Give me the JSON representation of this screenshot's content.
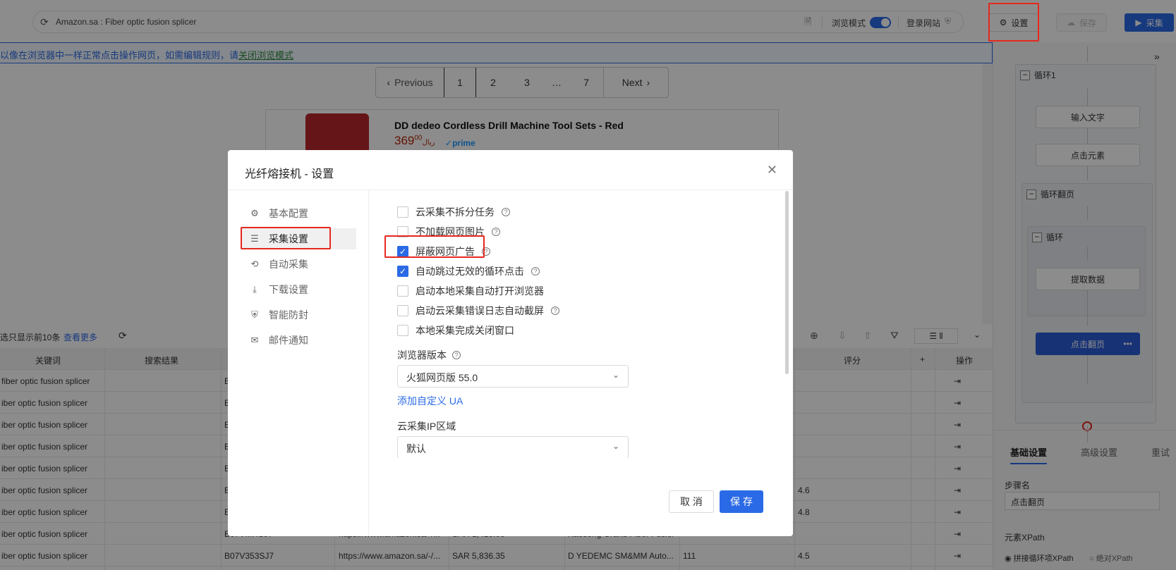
{
  "topbar": {
    "url": "Amazon.sa : Fiber optic fusion splicer",
    "browse_mode_label": "浏览模式",
    "login_site_label": "登录网站",
    "settings_label": "设置",
    "save_label": "保存",
    "collect_label": "采集"
  },
  "notice": {
    "text": "以像在浏览器中一样正常点击操作网页，如需编辑规则，请",
    "link": "关闭浏览模式"
  },
  "pagination": {
    "previous": "Previous",
    "pages": [
      "1",
      "2",
      "3",
      "…",
      "7"
    ],
    "next": "Next"
  },
  "product": {
    "title": "DD dedeo Cordless Drill Machine Tool Sets - Red",
    "currency": "ريال",
    "price": "369",
    "price_cents": "00",
    "prime": "prime"
  },
  "table_toolbar": {
    "info": "选只显示前10条",
    "more": "查看更多"
  },
  "table": {
    "headers": [
      "关键词",
      "搜索结果",
      "评分",
      "+",
      "操作"
    ],
    "rows": [
      {
        "keyword": "fiber optic fusion splicer",
        "col3": "B",
        "col4": "",
        "col5": "",
        "col6": "",
        "col7": "",
        "rating": ""
      },
      {
        "keyword": "iber optic fusion splicer",
        "col3": "B",
        "col4": "",
        "col5": "",
        "col6": "",
        "col7": "",
        "rating": ""
      },
      {
        "keyword": "iber optic fusion splicer",
        "col3": "B",
        "col4": "",
        "col5": "",
        "col6": "",
        "col7": "",
        "rating": ""
      },
      {
        "keyword": "iber optic fusion splicer",
        "col3": "B",
        "col4": "",
        "col5": "",
        "col6": "",
        "col7": "",
        "rating": ""
      },
      {
        "keyword": "iber optic fusion splicer",
        "col3": "B",
        "col4": "",
        "col5": "",
        "col6": "",
        "col7": "",
        "rating": ""
      },
      {
        "keyword": "iber optic fusion splicer",
        "col3": "B",
        "col4": "",
        "col5": "",
        "col6": "",
        "col7": "",
        "rating": "4.6"
      },
      {
        "keyword": "iber optic fusion splicer",
        "col3": "B",
        "col4": "",
        "col5": "",
        "col6": "",
        "col7": "",
        "rating": "4.8"
      },
      {
        "keyword": "iber optic fusion splicer",
        "col3": "B07VMRSJ7",
        "col4": "https://www.amazon.sa/-/...",
        "col5": "SAR 1,410.00",
        "col6": "Kaesong Grand Fiber Fusion...",
        "col7": "",
        "rating": ""
      },
      {
        "keyword": "iber optic fusion splicer",
        "col3": "B07V353SJ7",
        "col4": "https://www.amazon.sa/-/...",
        "col5": "SAR 5,836.35",
        "col6": "D YEDEMC SM&MM Auto...",
        "col7": "111",
        "rating": "4.5"
      }
    ]
  },
  "flow": {
    "loop1": "循环1",
    "input_text": "输入文字",
    "click_element": "点击元素",
    "loop_paging": "循环翻页",
    "loop": "循环",
    "extract_data": "提取数据",
    "click_paging": "点击翻页"
  },
  "right_panel": {
    "tabs": [
      "基础设置",
      "高级设置",
      "重试"
    ],
    "step_name_label": "步骤名",
    "step_name_value": "点击翻页",
    "xpath_label": "元素XPath",
    "radio_concat": "拼接循环项XPath",
    "radio_absolute": "绝对XPath"
  },
  "modal": {
    "title": "光纤熔接机 - 设置",
    "nav": [
      {
        "label": "基本配置",
        "icon": "gear-icon"
      },
      {
        "label": "采集设置",
        "icon": "list-icon"
      },
      {
        "label": "自动采集",
        "icon": "auto-icon"
      },
      {
        "label": "下载设置",
        "icon": "download-icon"
      },
      {
        "label": "智能防封",
        "icon": "shield-icon"
      },
      {
        "label": "邮件通知",
        "icon": "mail-icon"
      }
    ],
    "options": [
      {
        "label": "云采集不拆分任务",
        "checked": false,
        "help": true
      },
      {
        "label": "不加载网页图片",
        "checked": false,
        "help": true
      },
      {
        "label": "屏蔽网页广告",
        "checked": true,
        "help": true
      },
      {
        "label": "自动跳过无效的循环点击",
        "checked": true,
        "help": true
      },
      {
        "label": "启动本地采集自动打开浏览器",
        "checked": false,
        "help": false
      },
      {
        "label": "启动云采集错误日志自动截屏",
        "checked": false,
        "help": true
      },
      {
        "label": "本地采集完成关闭窗口",
        "checked": false,
        "help": false
      }
    ],
    "browser_version_label": "浏览器版本",
    "browser_version_value": "火狐网页版 55.0",
    "custom_ua_link": "添加自定义 UA",
    "cloud_ip_label": "云采集IP区域",
    "cloud_ip_value": "默认",
    "cancel_label": "取 消",
    "save_label": "保 存"
  },
  "colors": {
    "accent": "#2b6ae6",
    "highlight": "#e5281f",
    "bulb": "#e39a1c"
  }
}
